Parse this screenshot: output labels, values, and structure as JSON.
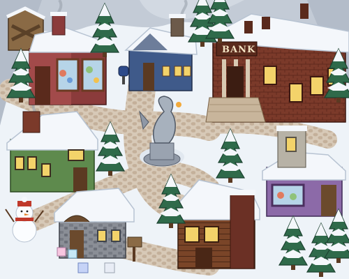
{
  "scene": {
    "title": "",
    "buildings": [
      {
        "id": "general-store",
        "kind": "storefront"
      },
      {
        "id": "blue-cottage",
        "kind": "house"
      },
      {
        "id": "bank",
        "kind": "bank",
        "sign": "BANK"
      },
      {
        "id": "green-house",
        "kind": "house"
      },
      {
        "id": "stone-cottage",
        "kind": "house"
      },
      {
        "id": "log-cabin",
        "kind": "cabin"
      },
      {
        "id": "purple-shop",
        "kind": "storefront"
      },
      {
        "id": "boarded-shack",
        "kind": "shack"
      }
    ],
    "landmarks": [
      "dragon-statue",
      "snowman",
      "mailbox",
      "signpost",
      "gift-cubes"
    ],
    "colors": {
      "snow": "#f4f7fb",
      "path": "#c9b9a7",
      "bank": "#7b3a2a",
      "green_house": "#5e8a4d",
      "blue_cottage": "#3f5a8a",
      "pine": "#2f6a4a",
      "window_glow": "#f3d36a"
    }
  }
}
